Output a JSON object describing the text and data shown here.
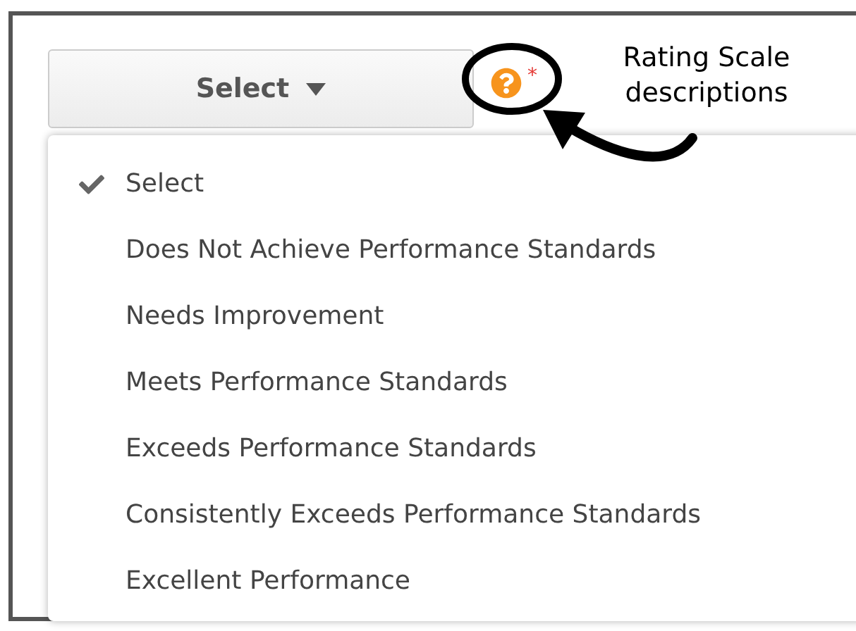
{
  "select_button": {
    "label": "Select"
  },
  "required_mark": "*",
  "callout": {
    "text": "Rating Scale descriptions"
  },
  "menu": {
    "items": [
      {
        "label": "Select",
        "selected": true
      },
      {
        "label": "Does Not Achieve Performance Standards",
        "selected": false
      },
      {
        "label": "Needs Improvement",
        "selected": false
      },
      {
        "label": "Meets Performance Standards",
        "selected": false
      },
      {
        "label": "Exceeds Performance Standards",
        "selected": false
      },
      {
        "label": "Consistently Exceeds Performance Standards",
        "selected": false
      },
      {
        "label": "Excellent Performance",
        "selected": false
      }
    ]
  }
}
